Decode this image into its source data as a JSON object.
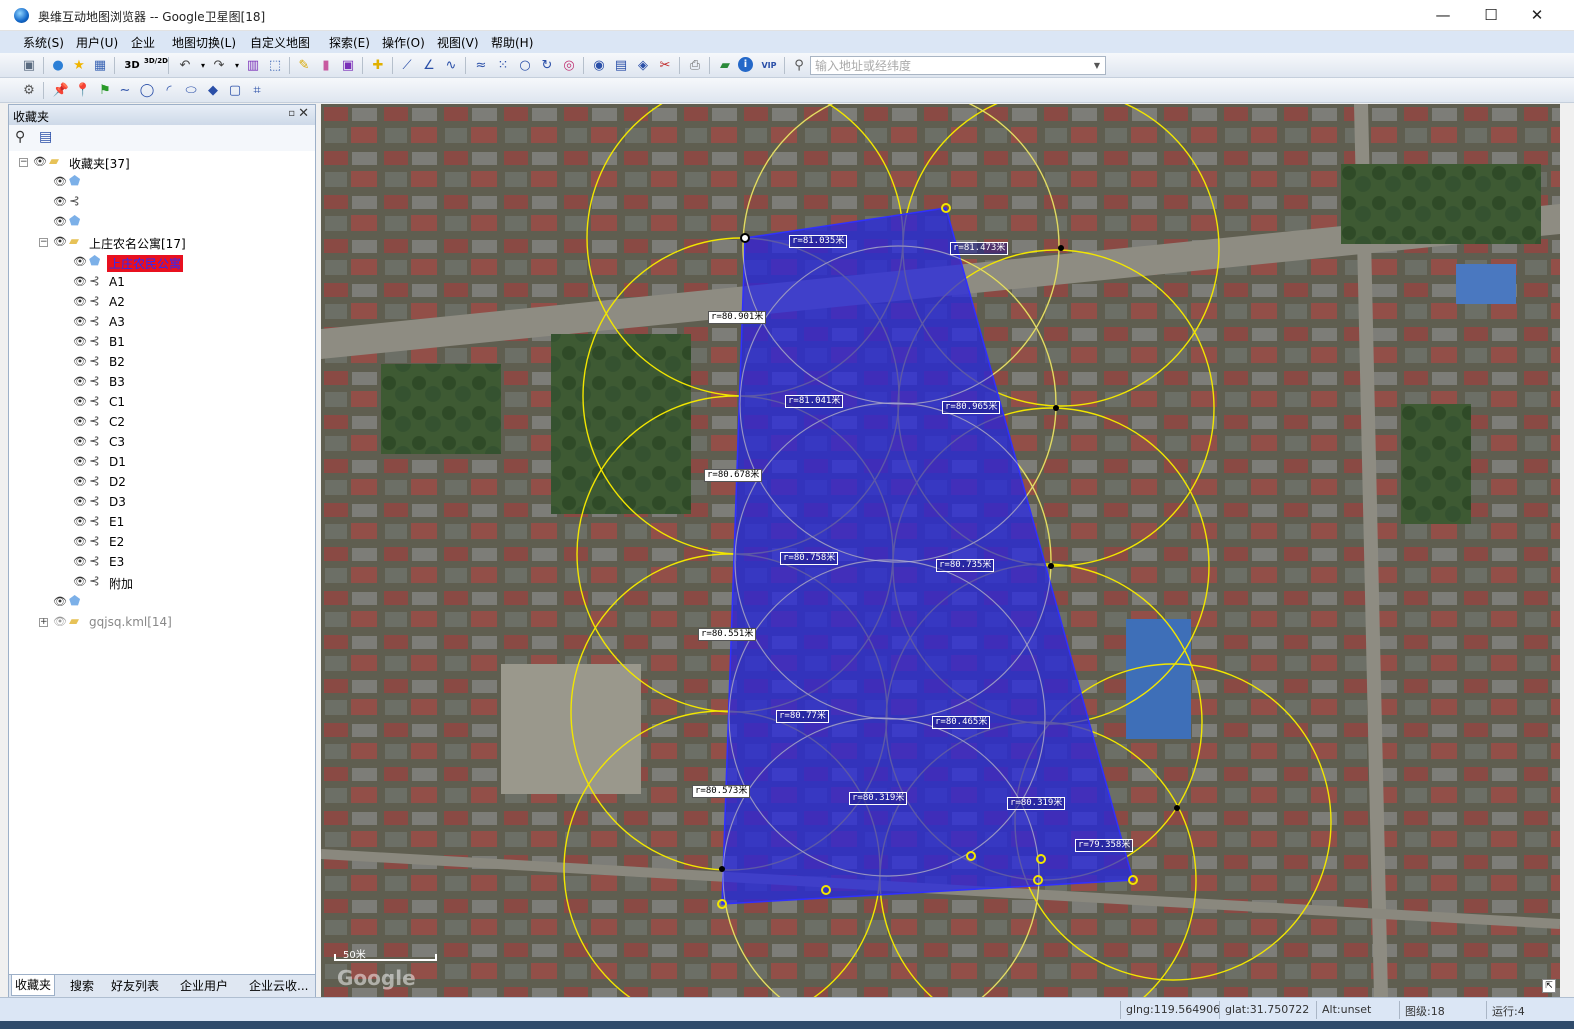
{
  "window": {
    "title": "奥维互动地图浏览器 -- Google卫星图[18]",
    "minimize": "—",
    "maximize": "☐",
    "close": "✕"
  },
  "menu": [
    "系统(S)",
    "用户(U)",
    "企业",
    "地图切换(L)",
    "自定义地图",
    "探索(E)",
    "操作(O)",
    "视图(V)",
    "帮助(H)"
  ],
  "toolbar": {
    "btn_3d": "3D",
    "btn_3d2d": "3D/2D",
    "btn_vip": "VIP",
    "search_placeholder": "输入地址或经纬度"
  },
  "panel": {
    "title": "收藏夹",
    "pin": "▫",
    "close": "✕",
    "tree": [
      {
        "label": "收藏夹[37]",
        "type": "folder",
        "level": 0,
        "expander": "−"
      },
      {
        "label": "",
        "type": "pentagon",
        "level": 1
      },
      {
        "label": "",
        "type": "route",
        "level": 1
      },
      {
        "label": "",
        "type": "pentagon",
        "level": 1
      },
      {
        "label": "上庄农名公寓[17]",
        "type": "folder",
        "level": 1,
        "expander": "−"
      },
      {
        "label": "上庄农民公寓",
        "type": "pentagon",
        "level": 2,
        "selected": true
      },
      {
        "label": "A1",
        "type": "route",
        "level": 2
      },
      {
        "label": "A2",
        "type": "route",
        "level": 2
      },
      {
        "label": "A3",
        "type": "route",
        "level": 2
      },
      {
        "label": "B1",
        "type": "route",
        "level": 2
      },
      {
        "label": "B2",
        "type": "route",
        "level": 2
      },
      {
        "label": "B3",
        "type": "route",
        "level": 2
      },
      {
        "label": "C1",
        "type": "route",
        "level": 2
      },
      {
        "label": "C2",
        "type": "route",
        "level": 2
      },
      {
        "label": "C3",
        "type": "route",
        "level": 2
      },
      {
        "label": "D1",
        "type": "route",
        "level": 2
      },
      {
        "label": "D2",
        "type": "route",
        "level": 2
      },
      {
        "label": "D3",
        "type": "route",
        "level": 2
      },
      {
        "label": "E1",
        "type": "route",
        "level": 2
      },
      {
        "label": "E2",
        "type": "route",
        "level": 2
      },
      {
        "label": "E3",
        "type": "route",
        "level": 2
      },
      {
        "label": "附加",
        "type": "route",
        "level": 2
      },
      {
        "label": "",
        "type": "pentagon",
        "level": 1
      },
      {
        "label": "gqjsq.kml[14]",
        "type": "folder",
        "level": 1,
        "expander": "+",
        "dim": true
      }
    ],
    "tabs": [
      "收藏夹",
      "搜索",
      "好友列表",
      "企业用户",
      "企业云收..."
    ]
  },
  "map": {
    "radius_labels": [
      "r=81.035米",
      "r=81.473米",
      "r=80.901米",
      "r=81.041米",
      "r=80.965米",
      "r=80.678米",
      "r=80.758米",
      "r=80.735米",
      "r=80.551米",
      "r=80.77米",
      "r=80.465米",
      "r=80.573米",
      "r=80.319米",
      "r=80.319米",
      "r=79.358米"
    ],
    "scale_text": "50米",
    "watermark": "Google",
    "polygon_color": "#2323e6",
    "circle_color": "#f2e600"
  },
  "status": {
    "lng": "glng:119.564906",
    "lat": "glat:31.750722",
    "alt": "Alt:unset",
    "level": "图级:18",
    "run": "运行:4"
  }
}
